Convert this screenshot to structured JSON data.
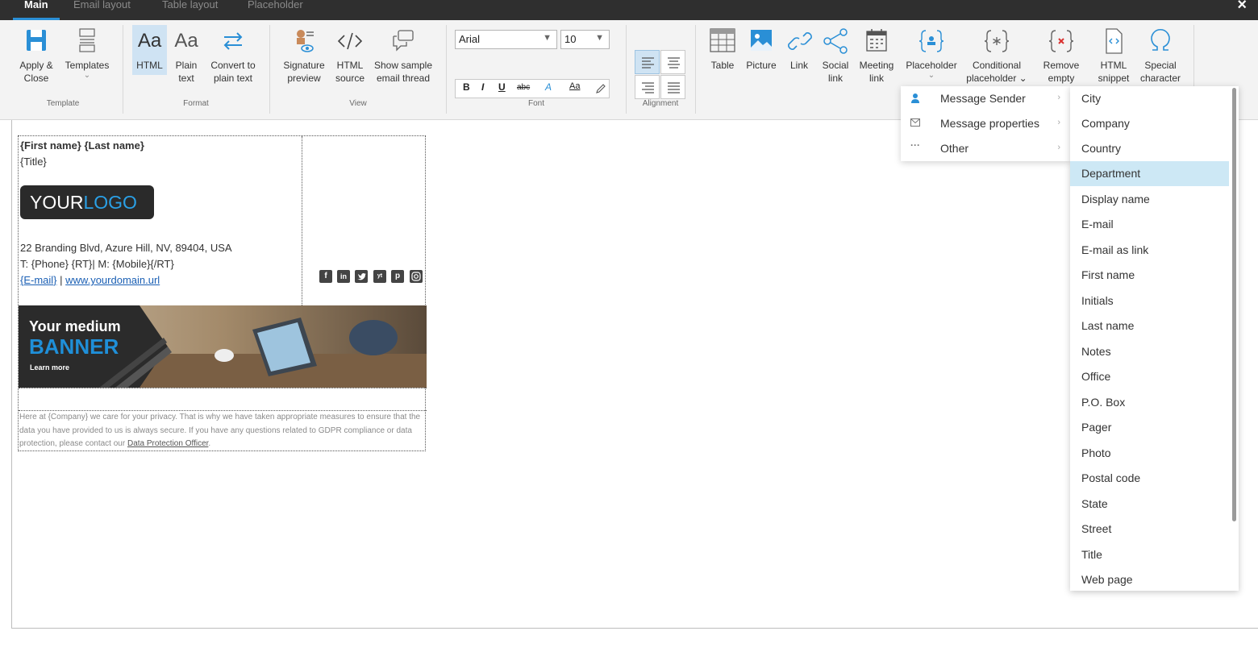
{
  "tabs": [
    {
      "label": "Main",
      "active": true
    },
    {
      "label": "Email layout",
      "active": false
    },
    {
      "label": "Table layout",
      "active": false
    },
    {
      "label": "Placeholder",
      "active": false
    }
  ],
  "close_label": "×",
  "ribbon": {
    "template_group": {
      "label": "Template",
      "apply_close": {
        "line1": "Apply &",
        "line2": "Close"
      },
      "templates": {
        "line1": "Templates",
        "line2": "⌄"
      }
    },
    "format_group": {
      "label": "Format",
      "html": {
        "icon_text": "Aa",
        "line1": "HTML"
      },
      "plain_text": {
        "icon_text": "Aa",
        "line1": "Plain",
        "line2": "text"
      },
      "convert": {
        "line1": "Convert to",
        "line2": "plain text"
      }
    },
    "view_group": {
      "label": "View",
      "signature_preview": {
        "line1": "Signature",
        "line2": "preview"
      },
      "html_source": {
        "line1": "HTML",
        "line2": "source"
      },
      "show_sample": {
        "line1": "Show sample",
        "line2": "email thread"
      }
    },
    "font_group": {
      "label": "Font",
      "font_name": "Arial",
      "font_size": "10",
      "bold": "B",
      "italic": "I",
      "underline": "U",
      "strike": "abc",
      "highlight": "A",
      "color": "Aa"
    },
    "alignment_group": {
      "label": "Alignment"
    },
    "insert_group": {
      "table": "Table",
      "picture": "Picture",
      "link": "Link",
      "social_link": {
        "line1": "Social",
        "line2": "link"
      },
      "meeting_link": {
        "line1": "Meeting",
        "line2": "link"
      },
      "placeholder": {
        "line1": "Placeholder",
        "line2": "⌄"
      },
      "conditional": {
        "line1": "Conditional",
        "line2": "placeholder ⌄"
      },
      "remove_empty": {
        "line1": "Remove",
        "line2": "empty"
      },
      "html_snippet": {
        "line1": "HTML",
        "line2": "snippet"
      },
      "special_char": {
        "line1": "Special",
        "line2": "character"
      }
    }
  },
  "signature": {
    "name_line": "{First name} {Last name}",
    "title_line": "{Title}",
    "logo_part1": "YOUR",
    "logo_part2": "LOGO",
    "address": "22 Branding Blvd, Azure Hill, NV, 89404, USA",
    "phone_line": "T: {Phone} {RT}| M: {Mobile}{/RT}",
    "email_link": "{E-mail}",
    "separator": " | ",
    "web_link": "www.yourdomain.url",
    "social_icons": [
      "f",
      "in",
      "t",
      "yt",
      "p",
      "ig"
    ],
    "banner_line1": "Your medium",
    "banner_line2": "BANNER",
    "banner_cta": "Learn more",
    "privacy_text": "Here at {Company} we care for your privacy. That is why we have taken appropriate measures to ensure that the data you have provided to us is always secure. If you have any questions related to GDPR compliance or data protection, please contact our ",
    "privacy_link": "Data Protection Officer",
    "privacy_end": "."
  },
  "placeholder_menu": [
    {
      "label": "Message Sender",
      "icon": "person-icon"
    },
    {
      "label": "Message properties",
      "icon": "envelope-icon"
    },
    {
      "label": "Other",
      "icon": "ellipsis-icon"
    }
  ],
  "sender_fields": [
    {
      "label": "City",
      "highlighted": false
    },
    {
      "label": "Company",
      "highlighted": false
    },
    {
      "label": "Country",
      "highlighted": false
    },
    {
      "label": "Department",
      "highlighted": true
    },
    {
      "label": "Display name",
      "highlighted": false
    },
    {
      "label": "E-mail",
      "highlighted": false
    },
    {
      "label": "E-mail as link",
      "highlighted": false
    },
    {
      "label": "First name",
      "highlighted": false
    },
    {
      "label": "Initials",
      "highlighted": false
    },
    {
      "label": "Last name",
      "highlighted": false
    },
    {
      "label": "Notes",
      "highlighted": false
    },
    {
      "label": "Office",
      "highlighted": false
    },
    {
      "label": "P.O. Box",
      "highlighted": false
    },
    {
      "label": "Pager",
      "highlighted": false
    },
    {
      "label": "Photo",
      "highlighted": false
    },
    {
      "label": "Postal code",
      "highlighted": false
    },
    {
      "label": "State",
      "highlighted": false
    },
    {
      "label": "Street",
      "highlighted": false
    },
    {
      "label": "Title",
      "highlighted": false
    },
    {
      "label": "Web page",
      "highlighted": false
    }
  ],
  "colors": {
    "accent": "#2a8fd6",
    "topbar": "#2f2f2f",
    "highlight": "#cde8f5"
  }
}
